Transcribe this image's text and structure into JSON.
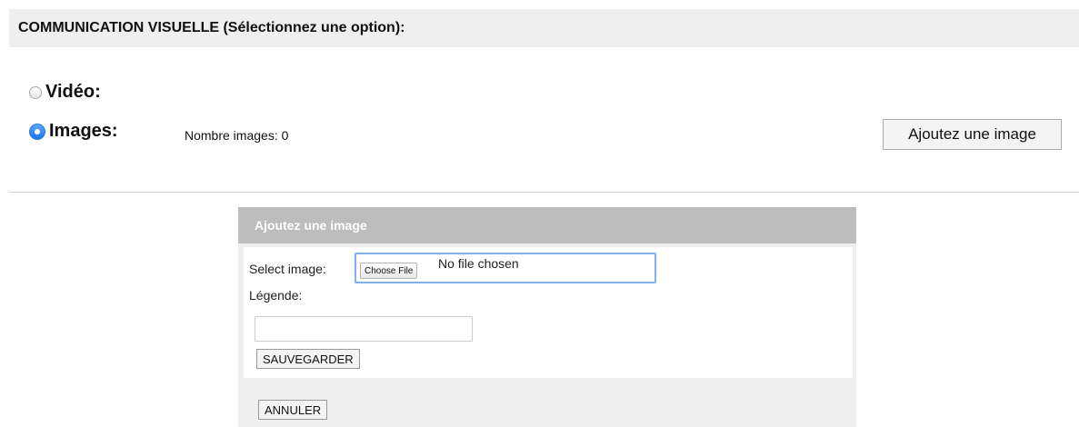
{
  "panel": {
    "title": "COMMUNICATION VISUELLE (Sélectionnez une option):",
    "options": [
      {
        "label": "Vidéo:",
        "checked": false
      },
      {
        "label": "Images:",
        "checked": true
      }
    ],
    "image_count_text": "Nombre images: 0",
    "add_button_label": "Ajoutez une image"
  },
  "dialog": {
    "title": "Ajoutez une image",
    "select_image_label": "Select image:",
    "choose_file_label": "Choose File",
    "no_file_text": "No file chosen",
    "caption_label": "Légende:",
    "caption_value": "",
    "save_button_label": "SAUVEGARDER",
    "cancel_button_label": "ANNULER"
  },
  "colors": {
    "accent": "#1f74e8",
    "dialog_header": "#bdbdbd"
  }
}
